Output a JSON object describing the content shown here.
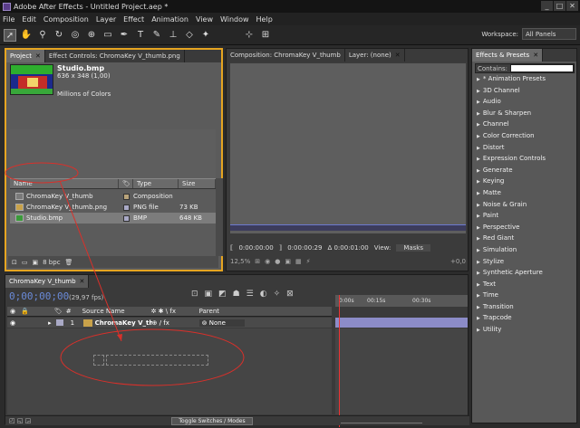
{
  "app": {
    "title": "Adobe After Effects - Untitled Project.aep *"
  },
  "menu": [
    "File",
    "Edit",
    "Composition",
    "Layer",
    "Effect",
    "Animation",
    "View",
    "Window",
    "Help"
  ],
  "workspace": {
    "label": "Workspace:",
    "value": "All Panels"
  },
  "project": {
    "tabs": [
      "Project",
      "Effect Controls: ChromaKey V_thumb.png"
    ],
    "selected": {
      "name": "Studio.bmp",
      "dims": "636 x 348 (1,00)",
      "colors": "Millions of Colors"
    },
    "columns": [
      "Name",
      "Type",
      "Size"
    ],
    "rows": [
      {
        "name": "ChromaKey V_thumb",
        "type": "Composition",
        "size": "",
        "color": "#b8a37a"
      },
      {
        "name": "ChromaKey V_thumb.png",
        "type": "PNG file",
        "size": "73 KB",
        "color": "#a9a9c6"
      },
      {
        "name": "Studio.bmp",
        "type": "BMP",
        "size": "648 KB",
        "color": "#a9a9c6"
      }
    ],
    "bpc": "8 bpc"
  },
  "comp": {
    "tabs": [
      "Composition: ChromaKey V_thumb",
      "Layer: (none)"
    ],
    "times": [
      "0:00:00:00",
      "0:00:00:29",
      "Δ 0:00:01:00"
    ],
    "view_label": "View:",
    "view_value": "Masks",
    "zoom": "12,5%",
    "exposure": "+0,0"
  },
  "effects": {
    "title": "Effects & Presets",
    "contains_label": "Contains:",
    "items": [
      "* Animation Presets",
      "3D Channel",
      "Audio",
      "Blur & Sharpen",
      "Channel",
      "Color Correction",
      "Distort",
      "Expression Controls",
      "Generate",
      "Keying",
      "Matte",
      "Noise & Grain",
      "Paint",
      "Perspective",
      "Red Giant",
      "Simulation",
      "Stylize",
      "Synthetic Aperture",
      "Text",
      "Time",
      "Transition",
      "Trapcode",
      "Utility"
    ]
  },
  "timeline": {
    "tab": "ChromaKey V_thumb",
    "timecode": "0;00;00;00",
    "fps": "(29,97 fps)",
    "source_header": "Source Name",
    "parent_header": "Parent",
    "layer": {
      "num": "1",
      "name": "ChromaKey V_thu",
      "parent": "None"
    },
    "ruler": [
      "0:00s",
      "00:15s",
      "00:30s"
    ],
    "toggle": "Toggle Switches / Modes"
  }
}
